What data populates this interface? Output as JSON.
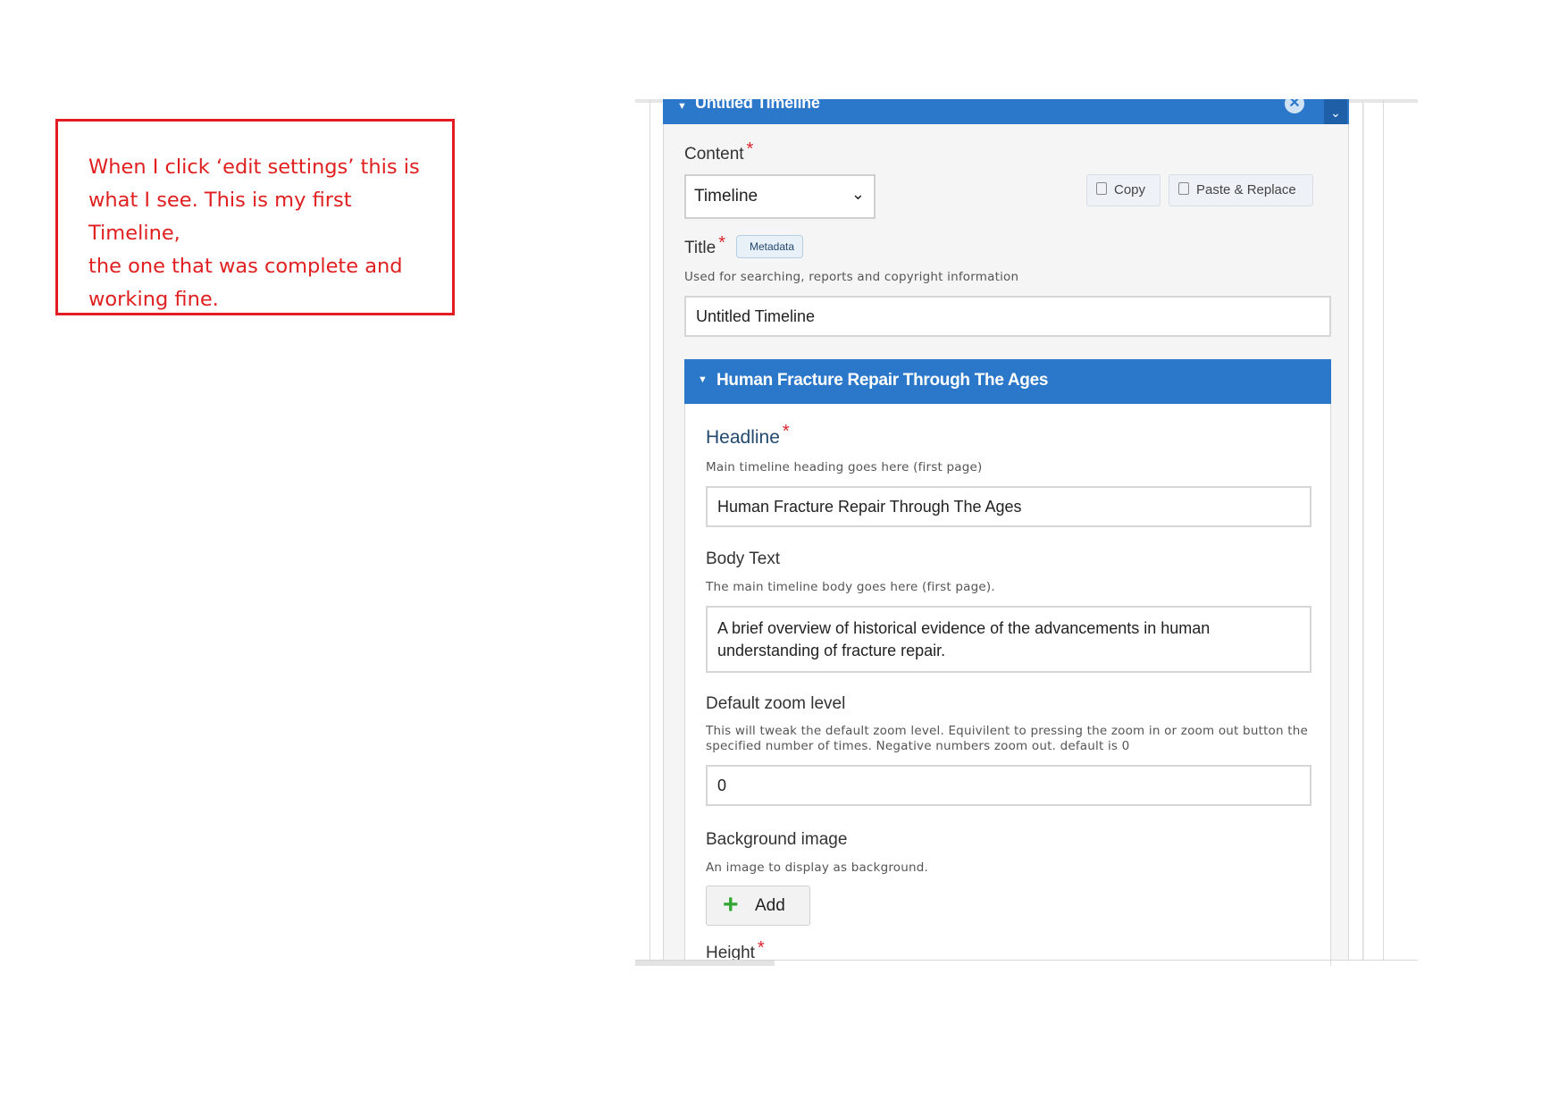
{
  "annotation": {
    "text_lines": [
      "When I click ‘edit settings’ this is",
      "what I see. This is my first Timeline,",
      "the one that was complete and",
      "working fine."
    ]
  },
  "editor": {
    "outer_panel": {
      "title": "Untitled Timeline"
    },
    "content": {
      "label": "Content",
      "required_mark": "*",
      "selected": "Timeline",
      "copy_label": "Copy",
      "paste_label": "Paste & Replace"
    },
    "title_field": {
      "label": "Title",
      "required_mark": "*",
      "tag": "Metadata",
      "description": "Used for searching, reports and copyright information",
      "value": "Untitled Timeline"
    },
    "inner_panel": {
      "title": "Human Fracture Repair Through The Ages"
    },
    "headline": {
      "label": "Headline",
      "required_mark": "*",
      "description": "Main timeline heading goes here (first page)",
      "value": "Human Fracture Repair Through The Ages"
    },
    "body_text": {
      "label": "Body Text",
      "description": "The main timeline body goes here (first page).",
      "value": "A brief overview of historical evidence of the advancements in human understanding of fracture repair."
    },
    "zoom": {
      "label": "Default zoom level",
      "description": "This will tweak the default zoom level. Equivilent to pressing the zoom in or zoom out button the specified number of times. Negative numbers zoom out. default is 0",
      "value": "0"
    },
    "background_image": {
      "label": "Background image",
      "description": "An image to display as background.",
      "add_label": "Add"
    },
    "height": {
      "label": "Height",
      "required_mark": "*"
    }
  },
  "colors": {
    "annotation_red": "#e31b23",
    "header_blue": "#2b77c9",
    "required_red": "#d9252b",
    "add_green": "#33a532"
  }
}
